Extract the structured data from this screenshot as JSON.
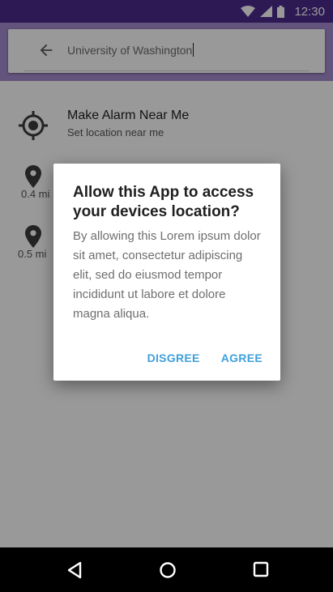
{
  "status_bar": {
    "time": "12:30",
    "icons": [
      "wifi-icon",
      "signal-icon",
      "battery-icon"
    ]
  },
  "search": {
    "value": "University of Washington",
    "back_icon": "arrow-left-icon"
  },
  "list": {
    "current_location": {
      "title": "Make Alarm Near Me",
      "subtitle": "Set location near me",
      "icon": "gps-target-icon"
    },
    "places": [
      {
        "distance": "0.4 mi",
        "title": "",
        "subtitle": "",
        "icon": "place-pin-icon"
      },
      {
        "distance": "0.5 mi",
        "title": "",
        "subtitle": "",
        "icon": "place-pin-icon"
      }
    ]
  },
  "dialog": {
    "title": "Allow this App to access your devices location?",
    "body": "By allowing this Lorem ipsum dolor sit amet, consectetur adipiscing elit, sed do eiusmod tempor incididunt ut labore et dolore magna aliqua.",
    "negative_label": "DISGREE",
    "positive_label": "AGREE"
  },
  "nav_bar": {
    "icons": [
      "back-triangle-icon",
      "home-circle-icon",
      "recents-square-icon"
    ]
  },
  "colors": {
    "status_bar": "#4b2a8c",
    "app_bar": "#a58cd0",
    "dialog_action": "#3fa0dc"
  }
}
